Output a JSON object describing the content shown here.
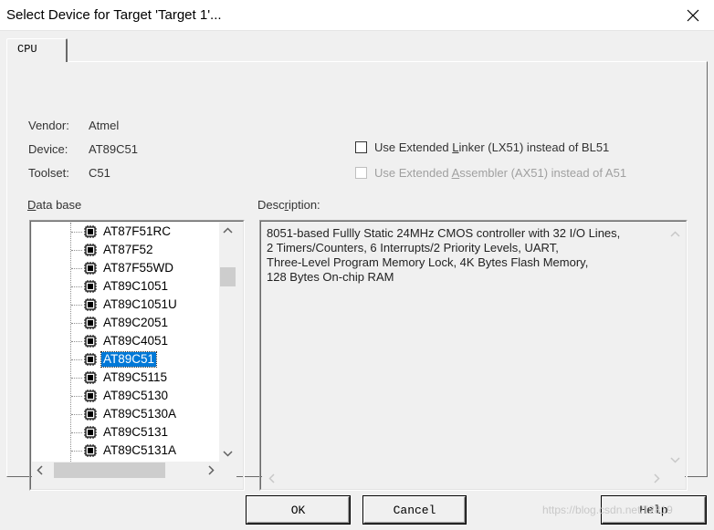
{
  "window": {
    "title": "Select Device for Target 'Target 1'..."
  },
  "tabs": [
    {
      "label": "CPU"
    }
  ],
  "info": {
    "vendor_label": "Vendor:",
    "vendor_value": "Atmel",
    "device_label": "Device:",
    "device_value": "AT89C51",
    "toolset_label": "Toolset:",
    "toolset_value": "C51"
  },
  "options": {
    "lx51": {
      "label_before": "Use Extended ",
      "label_accel": "L",
      "label_after": "inker (LX51) instead of BL51",
      "checked": false
    },
    "ax51": {
      "label_before": "Use Extended ",
      "label_accel": "A",
      "label_after": "ssembler (AX51) instead of A51",
      "checked": false,
      "enabled": false
    }
  },
  "database": {
    "label_accel": "D",
    "label_rest": "ata base",
    "items": [
      "AT87F51RC",
      "AT87F52",
      "AT87F55WD",
      "AT89C1051",
      "AT89C1051U",
      "AT89C2051",
      "AT89C4051",
      "AT89C51",
      "AT89C5115",
      "AT89C5130",
      "AT89C5130A",
      "AT89C5131",
      "AT89C5131A"
    ],
    "selected_index": 7
  },
  "description": {
    "label_before": "Desc",
    "label_accel": "r",
    "label_after": "iption:",
    "lines": [
      "8051-based Fullly Static 24MHz CMOS controller with 32  I/O Lines,",
      "2 Timers/Counters, 6 Interrupts/2 Priority Levels, UART,",
      "Three-Level Program Memory Lock, 4K Bytes Flash Memory,",
      "128 Bytes On-chip RAM"
    ]
  },
  "buttons": {
    "ok": "OK",
    "cancel": "Cancel",
    "help": "Help"
  },
  "watermark": "https://blog.csdn.net/li2819"
}
